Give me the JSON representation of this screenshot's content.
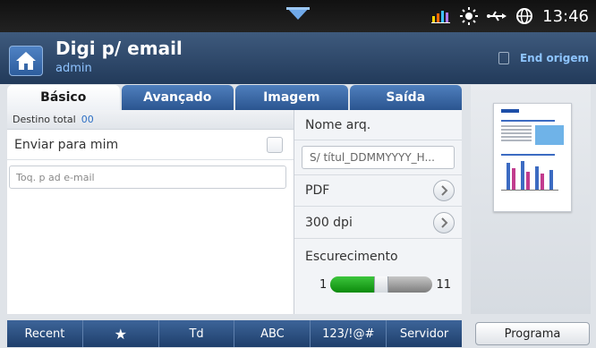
{
  "status_bar": {
    "time": "13:46",
    "icons": [
      "signal-bars-icon",
      "brightness-icon",
      "usb-icon",
      "globe-icon"
    ]
  },
  "header": {
    "title": "Digi p/ email",
    "subtitle": "admin",
    "end_origem": "End origem"
  },
  "tabs": [
    {
      "label": "Básico",
      "active": true
    },
    {
      "label": "Avançado",
      "active": false
    },
    {
      "label": "Imagem",
      "active": false
    },
    {
      "label": "Saída",
      "active": false
    }
  ],
  "left_panel": {
    "destino_label": "Destino total",
    "destino_count": "00",
    "send_to_me_label": "Enviar para mim",
    "send_to_me_checked": false,
    "email_placeholder": "Toq. p ad e-mail"
  },
  "right_panel": {
    "filename_label": "Nome arq.",
    "filename_value": "S/ títul_DDMMYYYY_H...",
    "format_value": "PDF",
    "resolution_value": "300 dpi",
    "darkness_label": "Escurecimento",
    "darkness_min": "1",
    "darkness_max": "11",
    "darkness_level_fraction": 0.5
  },
  "bottom_bar": {
    "recent": "Recent",
    "star": "★",
    "td": "Td",
    "abc": "ABC",
    "num": "123/!@#",
    "servidor": "Servidor"
  },
  "program_button": "Programa",
  "colors": {
    "accent_blue": "#2b5590",
    "slider_green": "#16a016",
    "link_blue": "#8ec5ff"
  }
}
